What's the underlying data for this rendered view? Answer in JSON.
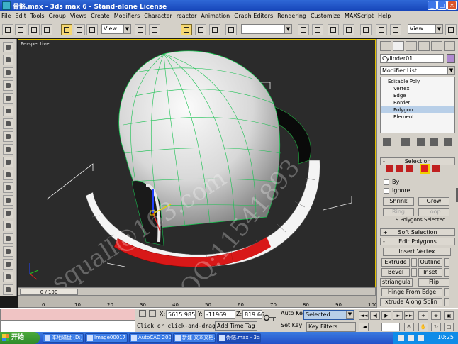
{
  "window": {
    "title": "骨骼.max - 3ds max 6 - Stand-alone License"
  },
  "menu": [
    "File",
    "Edit",
    "Tools",
    "Group",
    "Views",
    "Create",
    "Modifiers",
    "Character",
    "reactor",
    "Animation",
    "Graph Editors",
    "Rendering",
    "Customize",
    "MAXScript",
    "Help"
  ],
  "toolbar": {
    "view_dropdown": "View",
    "view_dropdown_right": "View"
  },
  "viewport": {
    "label": "Perspective",
    "watermark_1": "squall@163.com",
    "watermark_2": "QQ:11541893"
  },
  "timeline": {
    "slider": "0 / 100",
    "ticks": [
      "0",
      "10",
      "20",
      "30",
      "40",
      "50",
      "60",
      "70",
      "80",
      "90",
      "100"
    ]
  },
  "status": {
    "x_label": "X:",
    "x_value": "5615.985",
    "y_label": "Y:",
    "y_value": "-11969.",
    "z_label": "Z:",
    "z_value": "819.66",
    "prompt": "Click or click-and-drag",
    "add_time_tag": "Add Time Tag",
    "auto_key": "Auto Key",
    "set_key": "Set Key",
    "selected": "Selected",
    "key_filters": "Key Filters..."
  },
  "panel": {
    "object_name": "Cylinder01",
    "object_color": "#b08ad0",
    "modifier_list": "Modifier List",
    "stack": [
      {
        "label": "Editable Poly",
        "selected": false
      },
      {
        "label": "Vertex",
        "selected": false
      },
      {
        "label": "Edge",
        "selected": false
      },
      {
        "label": "Border",
        "selected": false
      },
      {
        "label": "Polygon",
        "selected": true
      },
      {
        "label": "Element",
        "selected": false
      }
    ],
    "selection_rollout": "Selection",
    "by_vertex": "By",
    "ignore": "Ignore",
    "shrink": "Shrink",
    "grow": "Grow",
    "ring": "Ring",
    "loop": "Loop",
    "selection_info": "9 Polygons Selected",
    "soft_selection_rollout": "Soft Selection",
    "edit_polygons_rollout": "Edit Polygons",
    "insert_vertex": "Insert Vertex",
    "extrude": "Extrude",
    "outline": "Outline",
    "bevel": "Bevel",
    "inset": "Inset",
    "triangulate": "striangula",
    "flip": "Flip",
    "hinge_from_edge": "Hinge From Edge",
    "extrude_along_spline": "xtrude Along Splin"
  },
  "taskbar": {
    "start": "开始",
    "items": [
      {
        "label": "本地磁盘 (D:)",
        "active": false
      },
      {
        "label": "Image00017 -...",
        "active": false
      },
      {
        "label": "AutoCAD 2004 ...",
        "active": false
      },
      {
        "label": "新建 文本文档...",
        "active": false
      },
      {
        "label": "骨骼.max - 3ds...",
        "active": true
      }
    ],
    "clock": "10:25"
  },
  "colors": {
    "accent_selected_faces": "#d81818",
    "wire": "#00e060",
    "selection_highlight": "#f6d872"
  }
}
